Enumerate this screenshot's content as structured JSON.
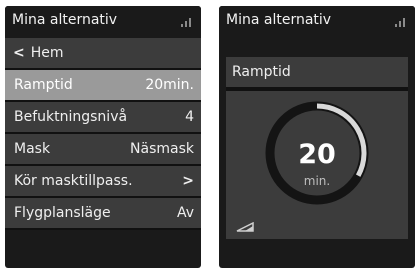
{
  "left_screen": {
    "title": "Mina alternativ",
    "back_label": "Hem",
    "items": [
      {
        "label": "Ramptid",
        "value": "20min.",
        "selected": true
      },
      {
        "label": "Befuktningsnivå",
        "value": "4"
      },
      {
        "label": "Mask",
        "value": "Näsmask"
      },
      {
        "label": "Kör masktillpass.",
        "value": ">"
      },
      {
        "label": "Flygplansläge",
        "value": "Av"
      }
    ]
  },
  "right_screen": {
    "title": "Mina alternativ",
    "panel_title": "Ramptid",
    "gauge": {
      "value": "20",
      "unit": "min.",
      "fill_fraction": 0.33
    }
  },
  "colors": {
    "selected": "#9a9a9a",
    "row": "#3c3c3c",
    "screen": "#1a1a1a"
  }
}
